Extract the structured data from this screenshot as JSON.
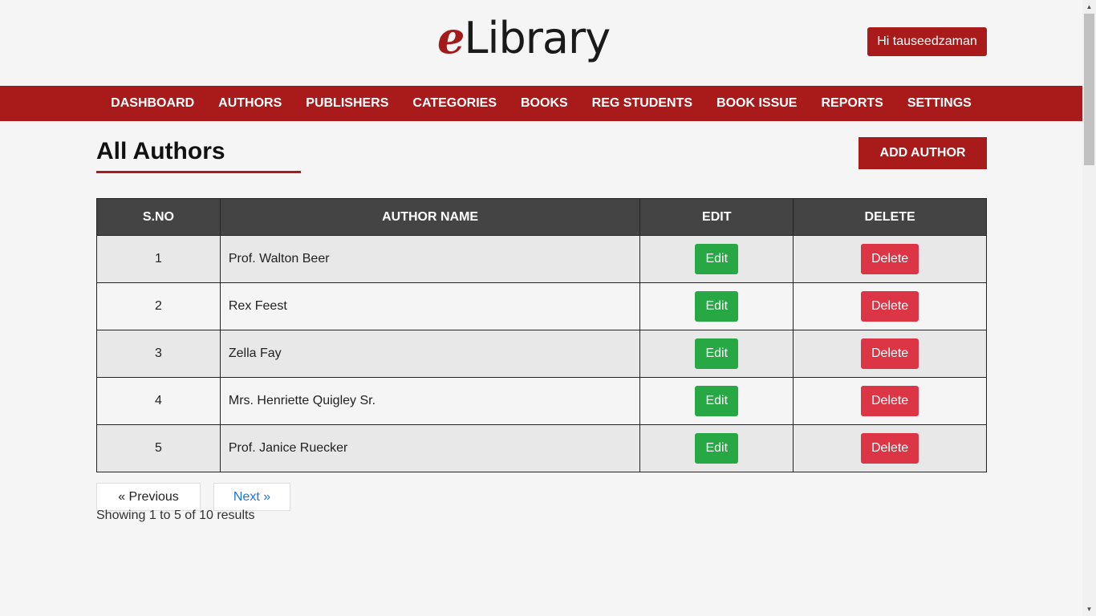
{
  "header": {
    "logo_e": "e",
    "logo_rest": "Library",
    "user_greeting": "Hi tauseedzaman"
  },
  "nav": {
    "items": [
      "DASHBOARD",
      "AUTHORS",
      "PUBLISHERS",
      "CATEGORIES",
      "BOOKS",
      "REG STUDENTS",
      "BOOK ISSUE",
      "REPORTS",
      "SETTINGS"
    ]
  },
  "page": {
    "title": "All Authors",
    "add_button": "ADD AUTHOR"
  },
  "table": {
    "headers": [
      "S.NO",
      "AUTHOR NAME",
      "EDIT",
      "DELETE"
    ],
    "edit_label": "Edit",
    "delete_label": "Delete",
    "rows": [
      {
        "sno": "1",
        "name": "Prof. Walton Beer"
      },
      {
        "sno": "2",
        "name": "Rex Feest"
      },
      {
        "sno": "3",
        "name": "Zella Fay"
      },
      {
        "sno": "4",
        "name": "Mrs. Henriette Quigley Sr."
      },
      {
        "sno": "5",
        "name": "Prof. Janice Ruecker"
      }
    ]
  },
  "pagination": {
    "prev": "« Previous",
    "next": "Next »",
    "summary": "Showing 1 to 5 of 10 results"
  },
  "colors": {
    "brand": "#a91a1b",
    "edit": "#28a745",
    "delete": "#dc3545",
    "table_header": "#444444"
  },
  "icons": {
    "scroll_up": "▲",
    "scroll_down": "▼"
  }
}
